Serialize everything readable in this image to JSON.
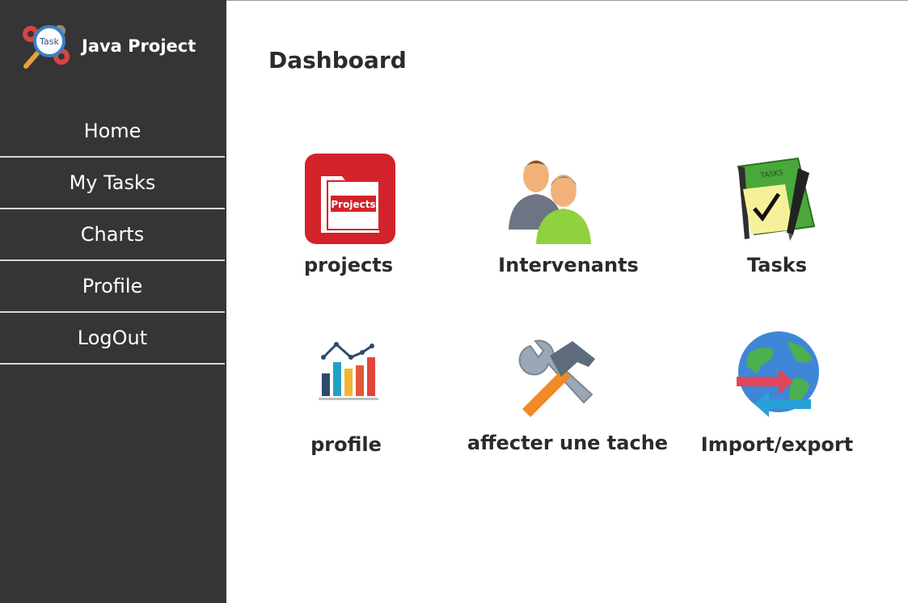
{
  "brand": {
    "logo_text": "Task",
    "title": "Java Project"
  },
  "sidebar": {
    "items": [
      {
        "label": "Home"
      },
      {
        "label": "My Tasks"
      },
      {
        "label": "Charts"
      },
      {
        "label": "Profile"
      },
      {
        "label": "LogOut"
      }
    ]
  },
  "main": {
    "title": "Dashboard",
    "tiles": [
      {
        "label": "projects",
        "icon": "projects-folder-icon",
        "icon_text": "Projects"
      },
      {
        "label": "Intervenants",
        "icon": "people-icon"
      },
      {
        "label": "Tasks",
        "icon": "tasks-book-icon",
        "icon_text": "TASKS"
      },
      {
        "label": "profile",
        "icon": "bar-chart-icon"
      },
      {
        "label": "affecter une tache",
        "icon": "tools-icon"
      },
      {
        "label": "Import/export",
        "icon": "globe-arrows-icon"
      }
    ]
  },
  "colors": {
    "sidebar_bg": "#353535",
    "projects_red": "#d3232a",
    "content_text": "#2b2b2b"
  }
}
